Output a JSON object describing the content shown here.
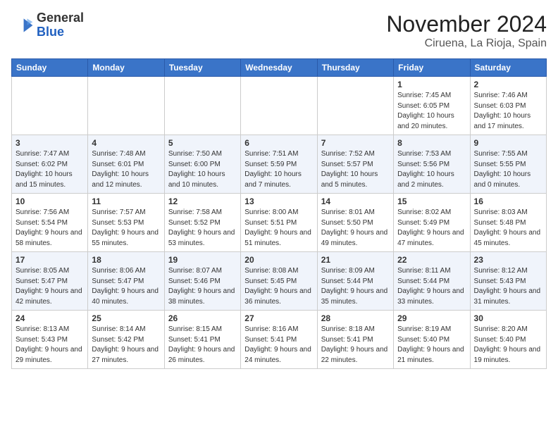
{
  "header": {
    "logo_general": "General",
    "logo_blue": "Blue",
    "month": "November 2024",
    "location": "Ciruena, La Rioja, Spain"
  },
  "weekdays": [
    "Sunday",
    "Monday",
    "Tuesday",
    "Wednesday",
    "Thursday",
    "Friday",
    "Saturday"
  ],
  "weeks": [
    [
      {
        "day": "",
        "info": ""
      },
      {
        "day": "",
        "info": ""
      },
      {
        "day": "",
        "info": ""
      },
      {
        "day": "",
        "info": ""
      },
      {
        "day": "",
        "info": ""
      },
      {
        "day": "1",
        "info": "Sunrise: 7:45 AM\nSunset: 6:05 PM\nDaylight: 10 hours and 20 minutes."
      },
      {
        "day": "2",
        "info": "Sunrise: 7:46 AM\nSunset: 6:03 PM\nDaylight: 10 hours and 17 minutes."
      }
    ],
    [
      {
        "day": "3",
        "info": "Sunrise: 7:47 AM\nSunset: 6:02 PM\nDaylight: 10 hours and 15 minutes."
      },
      {
        "day": "4",
        "info": "Sunrise: 7:48 AM\nSunset: 6:01 PM\nDaylight: 10 hours and 12 minutes."
      },
      {
        "day": "5",
        "info": "Sunrise: 7:50 AM\nSunset: 6:00 PM\nDaylight: 10 hours and 10 minutes."
      },
      {
        "day": "6",
        "info": "Sunrise: 7:51 AM\nSunset: 5:59 PM\nDaylight: 10 hours and 7 minutes."
      },
      {
        "day": "7",
        "info": "Sunrise: 7:52 AM\nSunset: 5:57 PM\nDaylight: 10 hours and 5 minutes."
      },
      {
        "day": "8",
        "info": "Sunrise: 7:53 AM\nSunset: 5:56 PM\nDaylight: 10 hours and 2 minutes."
      },
      {
        "day": "9",
        "info": "Sunrise: 7:55 AM\nSunset: 5:55 PM\nDaylight: 10 hours and 0 minutes."
      }
    ],
    [
      {
        "day": "10",
        "info": "Sunrise: 7:56 AM\nSunset: 5:54 PM\nDaylight: 9 hours and 58 minutes."
      },
      {
        "day": "11",
        "info": "Sunrise: 7:57 AM\nSunset: 5:53 PM\nDaylight: 9 hours and 55 minutes."
      },
      {
        "day": "12",
        "info": "Sunrise: 7:58 AM\nSunset: 5:52 PM\nDaylight: 9 hours and 53 minutes."
      },
      {
        "day": "13",
        "info": "Sunrise: 8:00 AM\nSunset: 5:51 PM\nDaylight: 9 hours and 51 minutes."
      },
      {
        "day": "14",
        "info": "Sunrise: 8:01 AM\nSunset: 5:50 PM\nDaylight: 9 hours and 49 minutes."
      },
      {
        "day": "15",
        "info": "Sunrise: 8:02 AM\nSunset: 5:49 PM\nDaylight: 9 hours and 47 minutes."
      },
      {
        "day": "16",
        "info": "Sunrise: 8:03 AM\nSunset: 5:48 PM\nDaylight: 9 hours and 45 minutes."
      }
    ],
    [
      {
        "day": "17",
        "info": "Sunrise: 8:05 AM\nSunset: 5:47 PM\nDaylight: 9 hours and 42 minutes."
      },
      {
        "day": "18",
        "info": "Sunrise: 8:06 AM\nSunset: 5:47 PM\nDaylight: 9 hours and 40 minutes."
      },
      {
        "day": "19",
        "info": "Sunrise: 8:07 AM\nSunset: 5:46 PM\nDaylight: 9 hours and 38 minutes."
      },
      {
        "day": "20",
        "info": "Sunrise: 8:08 AM\nSunset: 5:45 PM\nDaylight: 9 hours and 36 minutes."
      },
      {
        "day": "21",
        "info": "Sunrise: 8:09 AM\nSunset: 5:44 PM\nDaylight: 9 hours and 35 minutes."
      },
      {
        "day": "22",
        "info": "Sunrise: 8:11 AM\nSunset: 5:44 PM\nDaylight: 9 hours and 33 minutes."
      },
      {
        "day": "23",
        "info": "Sunrise: 8:12 AM\nSunset: 5:43 PM\nDaylight: 9 hours and 31 minutes."
      }
    ],
    [
      {
        "day": "24",
        "info": "Sunrise: 8:13 AM\nSunset: 5:43 PM\nDaylight: 9 hours and 29 minutes."
      },
      {
        "day": "25",
        "info": "Sunrise: 8:14 AM\nSunset: 5:42 PM\nDaylight: 9 hours and 27 minutes."
      },
      {
        "day": "26",
        "info": "Sunrise: 8:15 AM\nSunset: 5:41 PM\nDaylight: 9 hours and 26 minutes."
      },
      {
        "day": "27",
        "info": "Sunrise: 8:16 AM\nSunset: 5:41 PM\nDaylight: 9 hours and 24 minutes."
      },
      {
        "day": "28",
        "info": "Sunrise: 8:18 AM\nSunset: 5:41 PM\nDaylight: 9 hours and 22 minutes."
      },
      {
        "day": "29",
        "info": "Sunrise: 8:19 AM\nSunset: 5:40 PM\nDaylight: 9 hours and 21 minutes."
      },
      {
        "day": "30",
        "info": "Sunrise: 8:20 AM\nSunset: 5:40 PM\nDaylight: 9 hours and 19 minutes."
      }
    ]
  ]
}
